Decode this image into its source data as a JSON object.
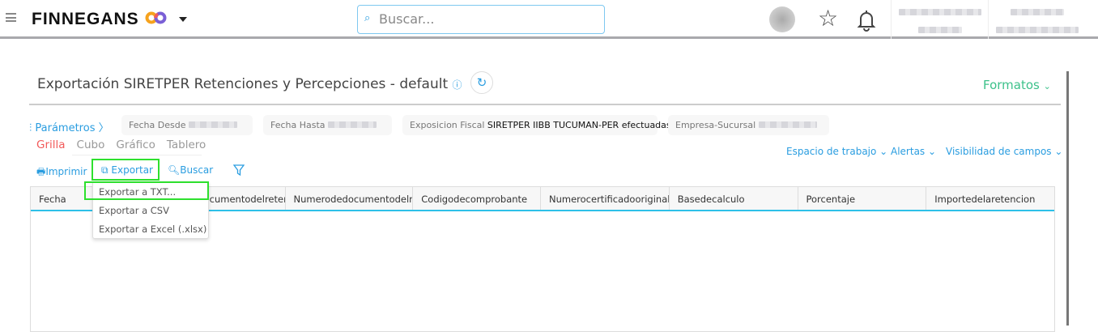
{
  "header": {
    "logo": "FINNEGANS",
    "search_placeholder": "Buscar..."
  },
  "page": {
    "title": "Exportación SIRETPER Retenciones y Percepciones - default",
    "formatos": "Formatos"
  },
  "params": {
    "label": "Parámetros 〉",
    "chips": [
      {
        "label": "Fecha Desde",
        "value": ""
      },
      {
        "label": "Fecha Hasta",
        "value": ""
      },
      {
        "label": "Exposicion Fiscal",
        "value": "SIRETPER IIBB TUCUMAN-PER efectuadas"
      },
      {
        "label": "Empresa-Sucursal",
        "value": ""
      }
    ]
  },
  "tabs": [
    "Grilla",
    "Cubo",
    "Gráfico",
    "Tablero"
  ],
  "toolbar": {
    "print": "Imprimir",
    "export": "Exportar",
    "search": "Buscar"
  },
  "right_links": [
    "Espacio de trabajo",
    "Alertas",
    "Visibilidad de campos"
  ],
  "columns": [
    "Fecha",
    "Tipodedocumentodelretenido",
    "Numerodedocumentodelretenido",
    "Codigodecomprobante",
    "Numerocertificadooriginal",
    "Basedecalculo",
    "Porcentaje",
    "Importedelaretencion"
  ],
  "export_menu": [
    "Exportar a TXT...",
    "Exportar a CSV",
    "Exportar a Excel (.xlsx)"
  ]
}
